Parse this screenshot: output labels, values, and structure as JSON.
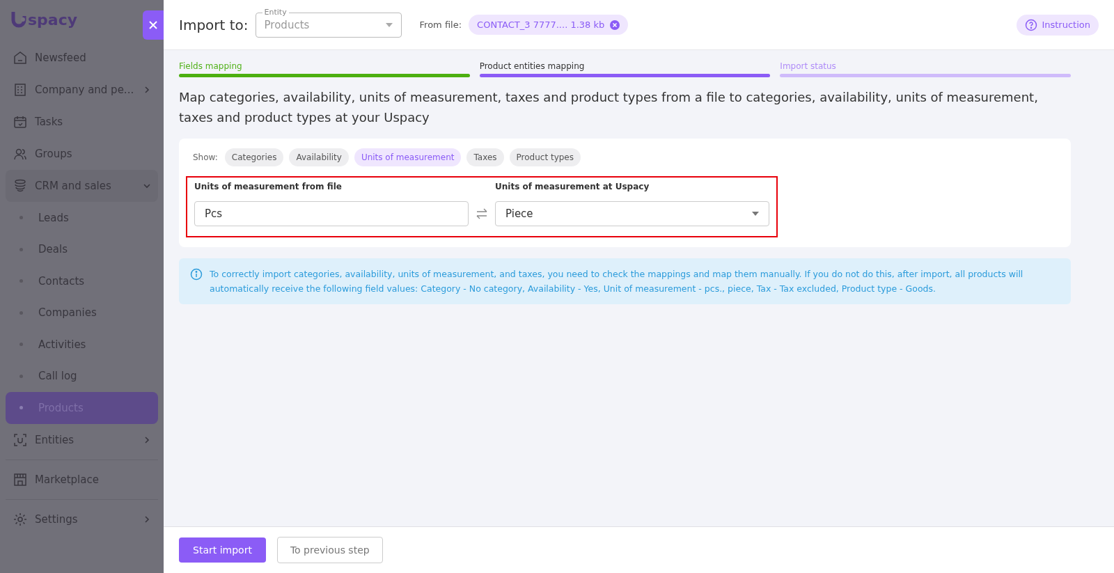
{
  "sidebar": {
    "logo": "spacy",
    "items": [
      {
        "label": "Newsfeed",
        "selected": false
      },
      {
        "label": "Company and pe...",
        "selected": false,
        "expanded": false
      },
      {
        "label": "Tasks",
        "selected": false
      },
      {
        "label": "Groups",
        "selected": false
      },
      {
        "label": "CRM and sales",
        "selected": false,
        "expanded": true,
        "children": [
          {
            "label": "Leads",
            "selected": false
          },
          {
            "label": "Deals",
            "selected": false
          },
          {
            "label": "Contacts",
            "selected": false
          },
          {
            "label": "Companies",
            "selected": false
          },
          {
            "label": "Activities",
            "selected": false
          },
          {
            "label": "Call log",
            "selected": false
          },
          {
            "label": "Products",
            "selected": true
          }
        ]
      },
      {
        "label": "Entities",
        "selected": false,
        "expanded": false
      },
      {
        "label": "Marketplace",
        "selected": false
      },
      {
        "label": "Settings",
        "selected": false,
        "expanded": false
      }
    ]
  },
  "header": {
    "title": "Import to:",
    "entity_field": {
      "label": "Entity",
      "value": "Products",
      "disabled": true
    },
    "from_file_label": "From file:",
    "file_chip": "CONTACT_3 7777.... 1.38 kb",
    "instruction_button": "Instruction"
  },
  "steps": [
    {
      "label": "Fields mapping",
      "completed": true,
      "selected": false
    },
    {
      "label": "Product entities mapping",
      "completed": false,
      "selected": true
    },
    {
      "label": "Import status",
      "completed": false,
      "selected": false
    }
  ],
  "heading": "Map categories, availability, units of measurement, taxes and product types from a file to categories, availability, units of measurement, taxes and product types at your Uspacy",
  "filter": {
    "label": "Show:",
    "chips": [
      {
        "label": "Categories",
        "selected": false
      },
      {
        "label": "Availability",
        "selected": false
      },
      {
        "label": "Units of measurement",
        "selected": true
      },
      {
        "label": "Taxes",
        "selected": false
      },
      {
        "label": "Product types",
        "selected": false
      }
    ]
  },
  "mapping": {
    "highlighted": true,
    "from_label": "Units of measurement from file",
    "to_label": "Units of measurement at Uspacy",
    "rows": [
      {
        "from": "Pcs",
        "to": "Piece"
      }
    ]
  },
  "info": "To correctly import categories, availability, units of measurement, and taxes, you need to check the mappings and map them manually. If you do not do this, after import, all products will automatically receive the following field values: Category - No category, Availability - Yes, Unit of measurement - pcs., piece, Tax - Tax excluded, Product type - Goods.",
  "footer": {
    "primary": "Start import",
    "secondary": "To previous step"
  }
}
